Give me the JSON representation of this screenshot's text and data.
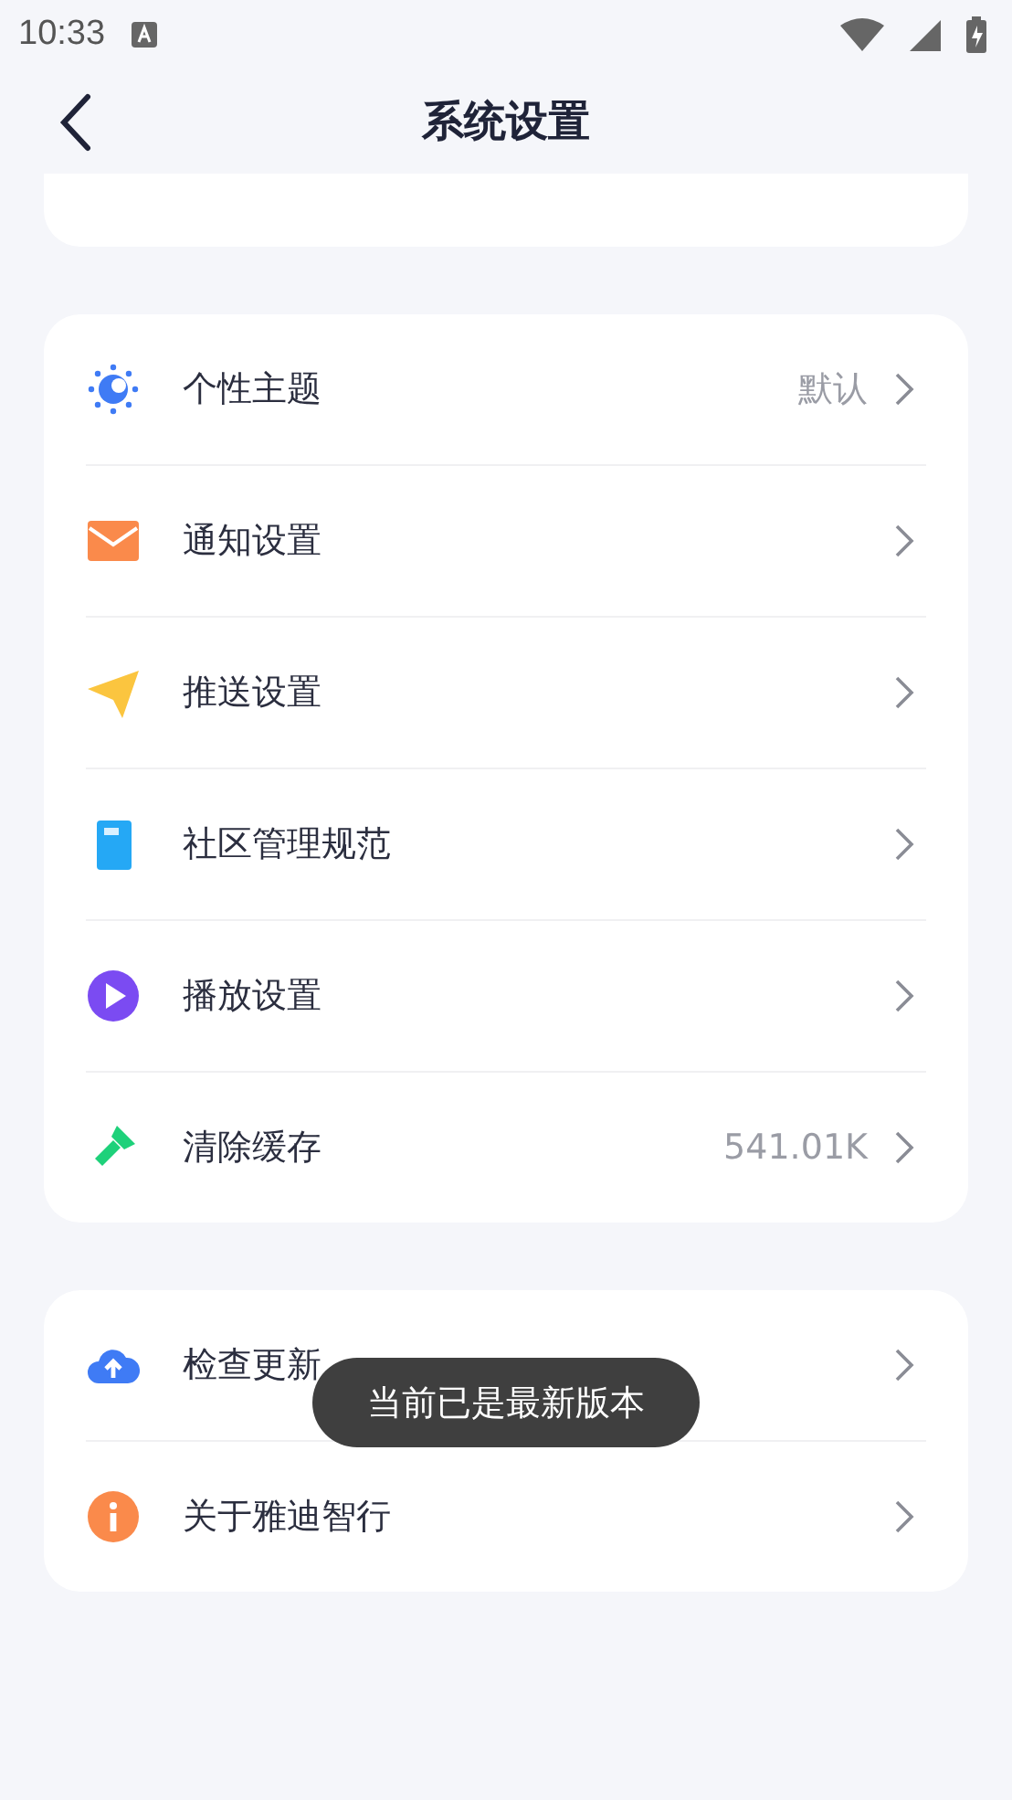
{
  "status_bar": {
    "time": "10:33"
  },
  "header": {
    "title": "系统设置"
  },
  "sections": [
    {
      "rows": [
        {
          "label": "个性主题",
          "value": "默认"
        },
        {
          "label": "通知设置"
        },
        {
          "label": "推送设置"
        },
        {
          "label": "社区管理规范"
        },
        {
          "label": "播放设置"
        },
        {
          "label": "清除缓存",
          "value": "541.01K"
        }
      ]
    },
    {
      "rows": [
        {
          "label": "检查更新"
        },
        {
          "label": "关于雅迪智行"
        }
      ]
    }
  ],
  "toast": {
    "text": "当前已是最新版本"
  }
}
